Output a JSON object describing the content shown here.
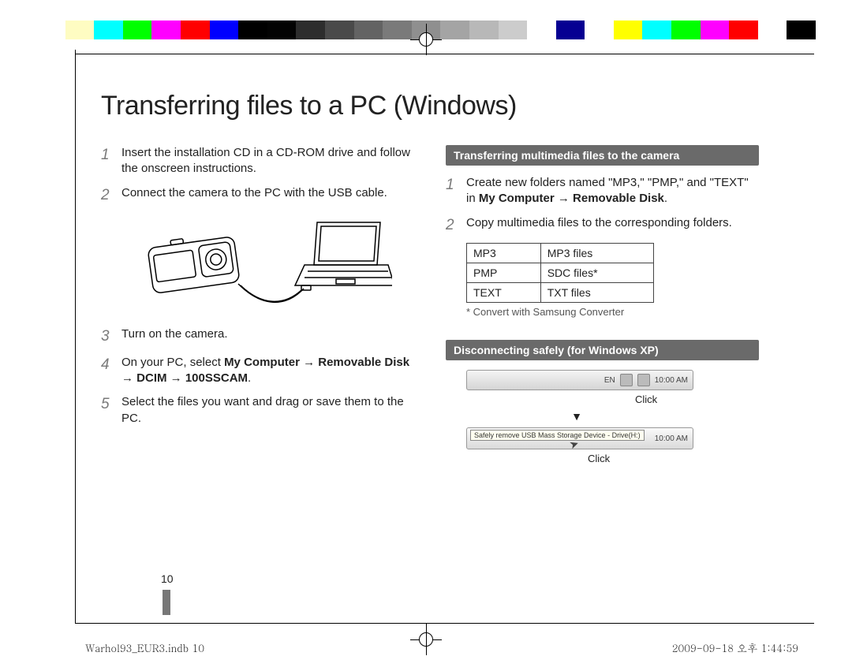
{
  "colorbar": [
    "#ffffff",
    "#fefcc2",
    "#00ffff",
    "#00ff00",
    "#ff00ff",
    "#ff0000",
    "#0000ff",
    "#000000",
    "#030303",
    "#2d2d2d",
    "#4a4a4a",
    "#636363",
    "#7a7a7a",
    "#8f8f8f",
    "#a4a4a4",
    "#b8b8b8",
    "#cccccc",
    "#ffffff",
    "#060092",
    "#ffffff",
    "#ffff00",
    "#00ffff",
    "#00ff00",
    "#ff00ff",
    "#ff0000",
    "#ffffff",
    "#000000"
  ],
  "title": "Transferring files to a PC (Windows)",
  "left_steps": [
    {
      "n": "1",
      "text": "Insert the installation CD in a CD-ROM drive and follow the onscreen instructions."
    },
    {
      "n": "2",
      "text": "Connect the camera to the PC with the USB cable."
    },
    {
      "n": "3",
      "text": "Turn on the camera."
    },
    {
      "n": "4",
      "pre": "On your PC, select ",
      "bold": "My Computer → Removable Disk → DCIM → 100SSCAM",
      "post": "."
    },
    {
      "n": "5",
      "text": "Select the files you want and drag or save them to the PC."
    }
  ],
  "right": {
    "heading1": "Transferring multimedia files to the camera",
    "r1_pre": "Create new folders named \"MP3,\" \"PMP,\" and \"TEXT\" in ",
    "r1_bold": "My Computer → Removable Disk",
    "r1_post": ".",
    "r2": "Copy multimedia files to the corresponding folders.",
    "table": [
      {
        "a": "MP3",
        "b": "MP3 files"
      },
      {
        "a": "PMP",
        "b": "SDC files*"
      },
      {
        "a": "TEXT",
        "b": "TXT files"
      }
    ],
    "footnote": "* Convert with Samsung Converter",
    "heading2": "Disconnecting safely (for Windows XP)",
    "taskbar_lang": "EN",
    "taskbar_time": "10:00 AM",
    "click": "Click",
    "arrow": "▼",
    "tooltip": "Safely remove USB Mass Storage Device - Drive(H:)"
  },
  "pagenum": "10",
  "footer_left": "Warhol93_EUR3.indb   10",
  "footer_right": "2009-09-18   오후 1:44:59"
}
